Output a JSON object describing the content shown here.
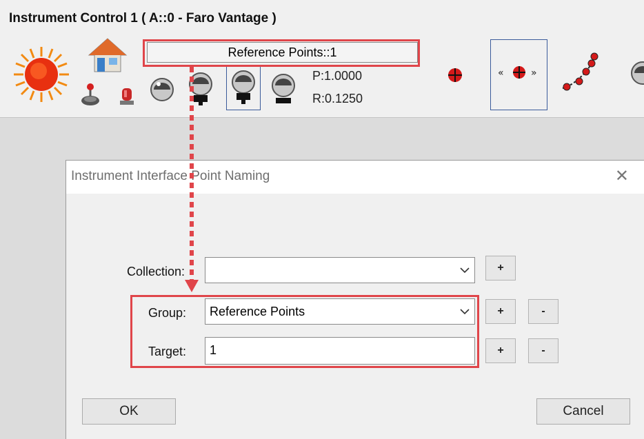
{
  "app": {
    "title": "Instrument Control 1 ( A::0 - Faro Vantage )"
  },
  "toolbar": {
    "reference_field": "Reference Points::1",
    "p_value": "P:1.0000",
    "r_value": "R:0.1250",
    "icons": [
      "status-sun-icon",
      "home-icon",
      "joystick-icon",
      "beacon-icon",
      "sphere-target-icon",
      "sphere-on-stand-icon",
      "sphere-on-stand-selected-icon",
      "sphere-target-stand-icon",
      "crosshair-target-icon",
      "multi-point-measure-icon",
      "spline-points-icon",
      "measure-partial-icon"
    ]
  },
  "dialog": {
    "title": "Instrument Interface Point Naming",
    "collection_label": "Collection:",
    "collection_value": "",
    "group_label": "Group:",
    "group_value": "Reference Points",
    "target_label": "Target:",
    "target_value": "1",
    "plus": "+",
    "minus": "-",
    "ok": "OK",
    "cancel": "Cancel"
  },
  "annotation": {
    "accent_color": "#e0454a"
  }
}
